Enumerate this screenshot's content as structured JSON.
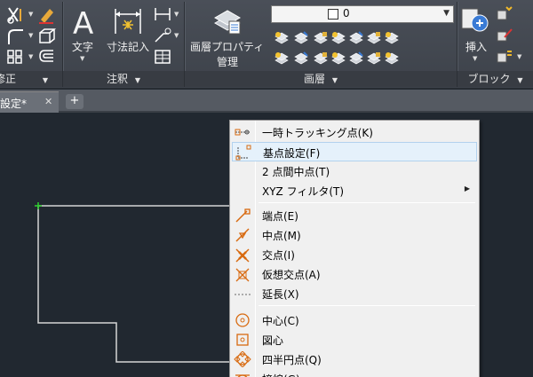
{
  "ribbon": {
    "panels": {
      "modify": {
        "title": "修正"
      },
      "annotation": {
        "title": "注釈",
        "text_label": "文字",
        "dim_label": "寸法記入"
      },
      "layers": {
        "title": "画層",
        "props_label_line1": "画層プロパティ",
        "props_label_line2": "管理",
        "current_layer": "0"
      },
      "block": {
        "title": "ブロック",
        "insert_label": "挿入"
      }
    }
  },
  "tabs": {
    "document_tab": "設定*"
  },
  "context_menu": {
    "items": [
      {
        "label": "一時トラッキング点(K)",
        "icon": "temp-tracking-icon"
      },
      {
        "label": "基点設定(F)",
        "icon": "from-icon",
        "highlighted": true
      },
      {
        "label": "2 点間中点(T)",
        "icon": ""
      },
      {
        "label": "XYZ フィルタ(T)",
        "icon": "",
        "submenu": true
      },
      {
        "label": "端点(E)",
        "icon": "endpoint-icon"
      },
      {
        "label": "中点(M)",
        "icon": "midpoint-icon"
      },
      {
        "label": "交点(I)",
        "icon": "intersection-icon"
      },
      {
        "label": "仮想交点(A)",
        "icon": "apparent-intersection-icon"
      },
      {
        "label": "延長(X)",
        "icon": "extension-icon"
      },
      {
        "label": "中心(C)",
        "icon": "center-icon"
      },
      {
        "label": "図心",
        "icon": "geometric-center-icon"
      },
      {
        "label": "四半円点(Q)",
        "icon": "quadrant-icon"
      },
      {
        "label": "接線(G)",
        "icon": "tangent-icon"
      }
    ]
  },
  "colors": {
    "canvas": "#212830",
    "ribbon": "#434851",
    "menu_bg": "#f0f0f0",
    "highlight": "#e5f1fb",
    "snap_orange": "#d86a10"
  }
}
